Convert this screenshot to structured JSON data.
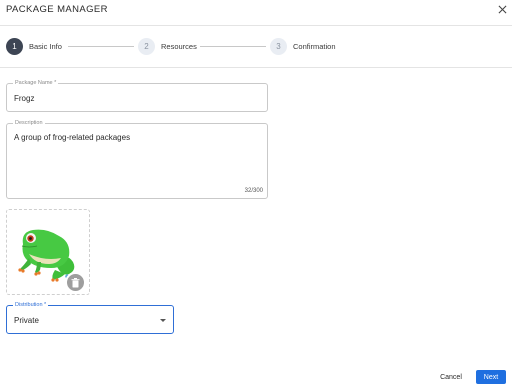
{
  "dialog": {
    "title": "PACKAGE MANAGER",
    "close_icon": "close-icon"
  },
  "stepper": {
    "steps": [
      {
        "number": "1",
        "label": "Basic Info",
        "state": "active"
      },
      {
        "number": "2",
        "label": "Resources",
        "state": "inactive"
      },
      {
        "number": "3",
        "label": "Confirmation",
        "state": "inactive"
      }
    ]
  },
  "form": {
    "package_name": {
      "label": "Package Name *",
      "value": "Frogz"
    },
    "description": {
      "label": "Description",
      "value": "A group of frog-related packages",
      "counter": "32/300"
    },
    "image": {
      "delete_icon": "trash-icon"
    },
    "distribution": {
      "label": "Distribution *",
      "value": "Private"
    }
  },
  "actions": {
    "cancel_label": "Cancel",
    "next_label": "Next"
  },
  "colors": {
    "accent": "#1f6fe0",
    "active_step": "#3d4554"
  }
}
